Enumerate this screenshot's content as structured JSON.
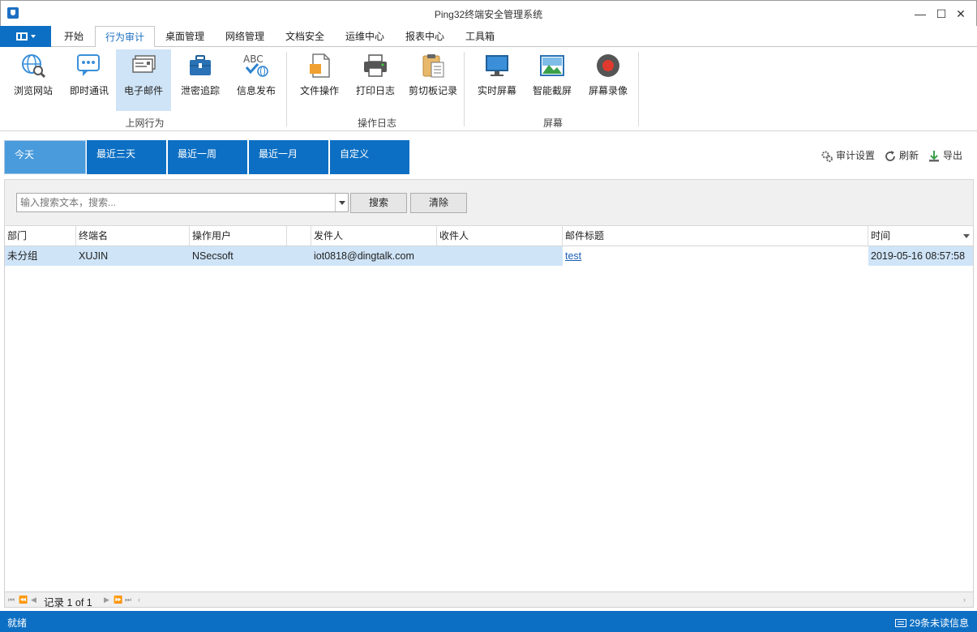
{
  "window": {
    "title": "Ping32终端安全管理系统",
    "minimize": "—",
    "maximize": "☐",
    "close": "✕"
  },
  "tabs": [
    {
      "label": "开始"
    },
    {
      "label": "行为审计"
    },
    {
      "label": "桌面管理"
    },
    {
      "label": "网络管理"
    },
    {
      "label": "文档安全"
    },
    {
      "label": "运维中心"
    },
    {
      "label": "报表中心"
    },
    {
      "label": "工具箱"
    }
  ],
  "ribbon": {
    "groups": [
      "上网行为",
      "操作日志",
      "屏幕"
    ],
    "buttons": [
      {
        "label": "浏览网站"
      },
      {
        "label": "即时通讯"
      },
      {
        "label": "电子邮件"
      },
      {
        "label": "泄密追踪"
      },
      {
        "label": "信息发布"
      },
      {
        "label": "文件操作"
      },
      {
        "label": "打印日志"
      },
      {
        "label": "剪切板记录"
      },
      {
        "label": "实时屏幕"
      },
      {
        "label": "智能截屏"
      },
      {
        "label": "屏幕录像"
      }
    ],
    "abc_text": "ABC"
  },
  "ranges": [
    {
      "label": "今天"
    },
    {
      "label": "最近三天"
    },
    {
      "label": "最近一周"
    },
    {
      "label": "最近一月"
    },
    {
      "label": "自定义"
    }
  ],
  "tools": {
    "settings": "审计设置",
    "refresh": "刷新",
    "export": "导出"
  },
  "search": {
    "placeholder": "输入搜索文本，搜索...",
    "search_btn": "搜索",
    "clear_btn": "清除"
  },
  "grid": {
    "columns": [
      "部门",
      "终端名",
      "操作用户",
      "",
      "发件人",
      "收件人",
      "邮件标题",
      "时间"
    ],
    "rows": [
      {
        "dept": "未分组",
        "terminal": "XUJIN",
        "user": "NSecsoft",
        "sender": "iot0818@dingtalk.com",
        "receiver": "",
        "subject": "test",
        "time": "2019-05-16 08:57:58"
      }
    ]
  },
  "pager": {
    "text": "记录 1 of 1"
  },
  "status": {
    "left": "就绪",
    "right": "29条未读信息"
  },
  "colors": {
    "accent": "#0d6fc3",
    "selected": "#cfe4f7"
  }
}
